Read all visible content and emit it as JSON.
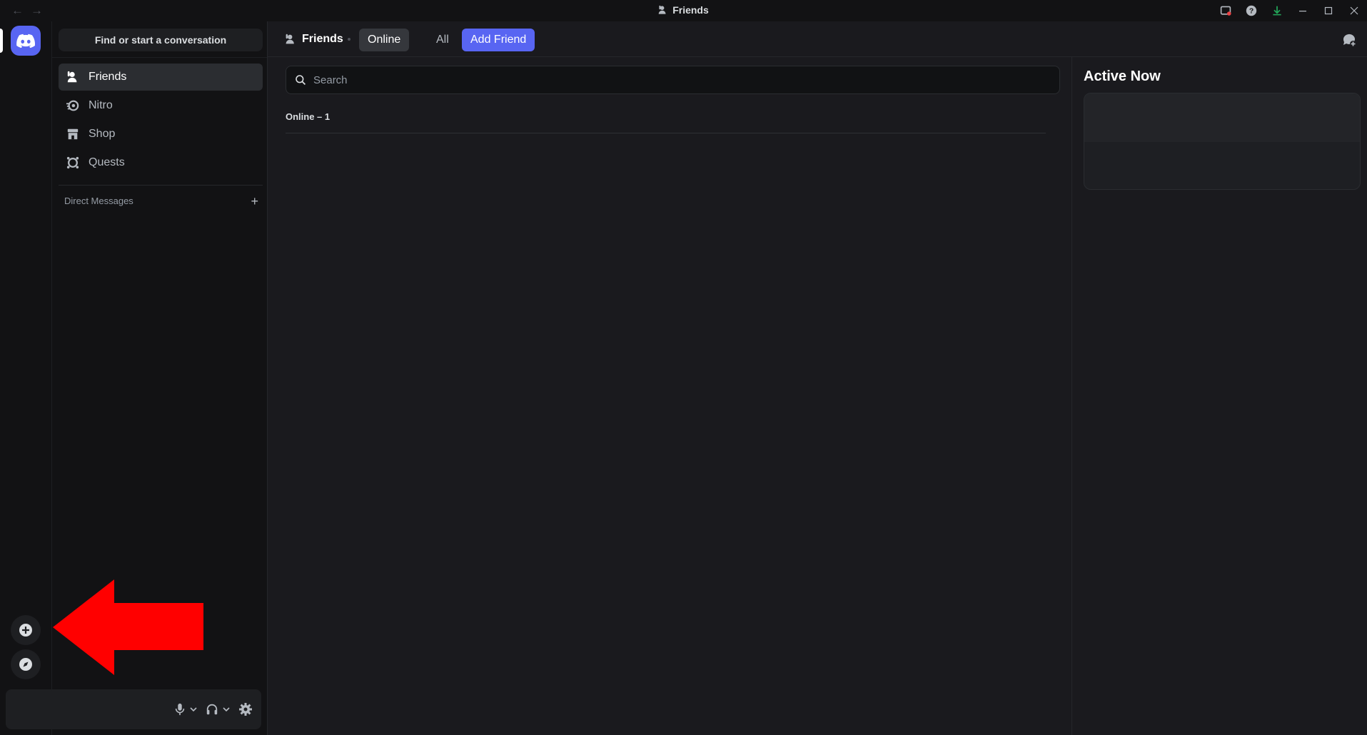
{
  "window": {
    "title": "Friends",
    "icons": [
      "back-arrow-icon",
      "forward-arrow-icon",
      "inbox-icon",
      "help-icon",
      "download-icon",
      "minimize-icon",
      "maximize-icon",
      "close-icon"
    ]
  },
  "sidebar": {
    "search_placeholder": "Find or start a conversation",
    "items": [
      {
        "label": "Friends",
        "icon": "friends-icon",
        "active": true
      },
      {
        "label": "Nitro",
        "icon": "nitro-icon"
      },
      {
        "label": "Shop",
        "icon": "shop-icon"
      },
      {
        "label": "Quests",
        "icon": "quests-icon"
      }
    ],
    "dm_header": "Direct Messages",
    "dm_add_symbol": "+"
  },
  "topbar": {
    "title": "Friends",
    "tabs": [
      {
        "label": "Online",
        "selected": true
      },
      {
        "label": "All"
      },
      {
        "label": "Add Friend",
        "accent": true
      }
    ]
  },
  "friends": {
    "search_placeholder": "Search",
    "online_count_label": "Online – 1"
  },
  "active_now": {
    "title": "Active Now"
  },
  "colors": {
    "accent": "#5865f2",
    "annotation_arrow": "#ff0000",
    "background": "#1a1a1e"
  }
}
